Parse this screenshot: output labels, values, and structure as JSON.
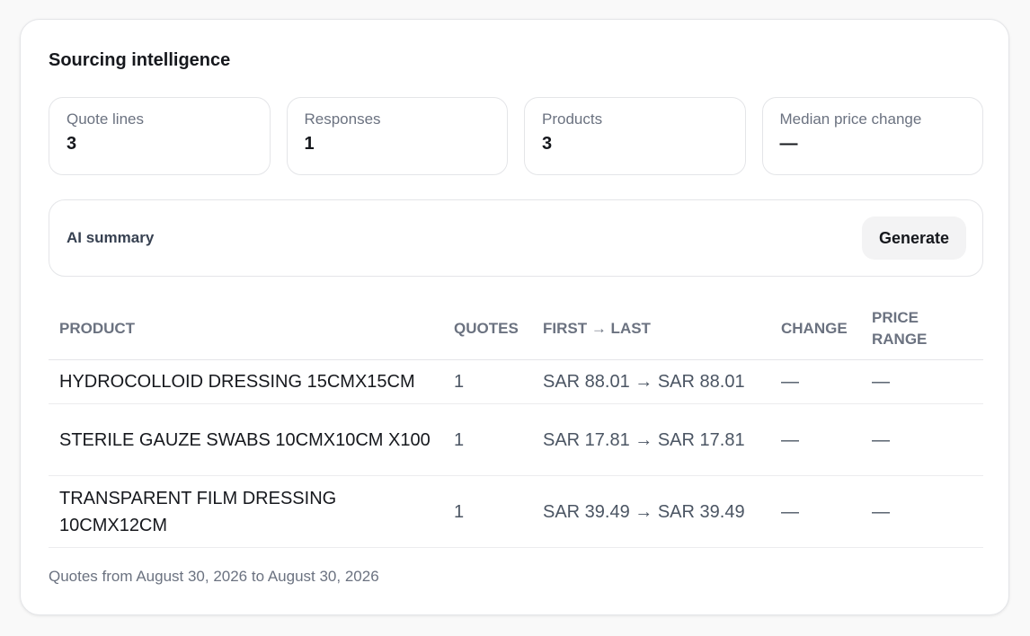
{
  "title": "Sourcing intelligence",
  "stats": [
    {
      "label": "Quote lines",
      "value": "3"
    },
    {
      "label": "Responses",
      "value": "1"
    },
    {
      "label": "Products",
      "value": "3"
    },
    {
      "label": "Median price change",
      "value": "—"
    }
  ],
  "ai_summary": {
    "label": "AI summary",
    "button_label": "Generate"
  },
  "table": {
    "headers": [
      "Product",
      "Quotes",
      "First → Last",
      "Change",
      "Price range"
    ],
    "rows": [
      {
        "product": "HYDROCOLLOID DRESSING 15CMX15CM",
        "quotes": "1",
        "first_last": "SAR 88.01 → SAR 88.01",
        "change": "—",
        "price_range": "—"
      },
      {
        "product": "STERILE GAUZE SWABS 10CMX10CM X100",
        "quotes": "1",
        "first_last": "SAR 17.81 → SAR 17.81",
        "change": "—",
        "price_range": "—"
      },
      {
        "product": "TRANSPARENT FILM DRESSING 10CMX12CM",
        "quotes": "1",
        "first_last": "SAR 39.49 → SAR 39.49",
        "change": "—",
        "price_range": "—"
      }
    ]
  },
  "footer": "Quotes from August 30, 2026 to August 30, 2026"
}
